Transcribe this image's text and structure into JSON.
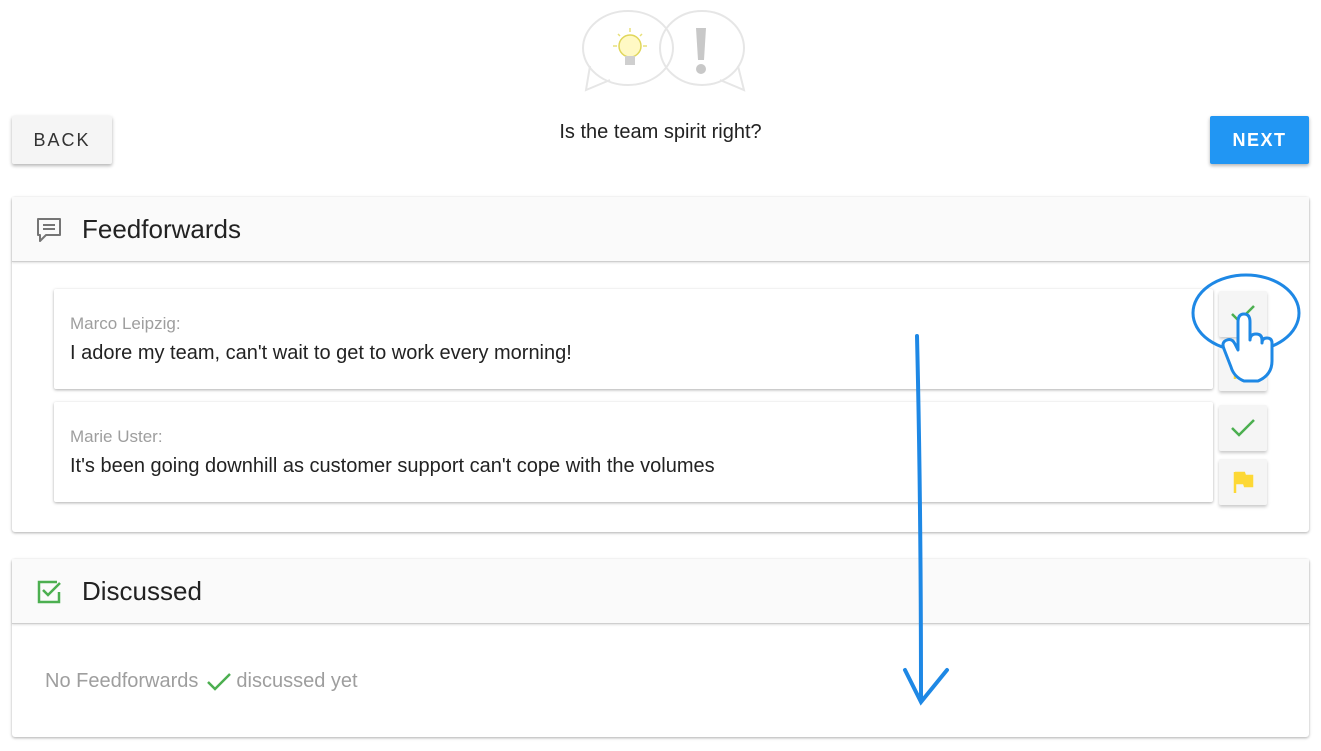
{
  "header": {
    "logo_icons": [
      "lightbulb-icon",
      "exclamation-icon"
    ],
    "back_label": "BACK",
    "next_label": "NEXT",
    "question": "Is the team spirit right?"
  },
  "feedforwards": {
    "title": "Feedforwards",
    "icon": "comment-icon",
    "items": [
      {
        "author": "Marco Leipzig:",
        "message": "I adore my team, can't wait to get to work every morning!"
      },
      {
        "author": "Marie Uster:",
        "message": "It's been going downhill as customer support can't cope with the volumes"
      }
    ],
    "actions": [
      "check-icon",
      "flag-icon"
    ]
  },
  "discussed": {
    "title": "Discussed",
    "icon": "checkbox-icon",
    "empty_prefix": "No Feedforwards",
    "empty_suffix": "discussed yet"
  },
  "colors": {
    "primary": "#2196f3",
    "check": "#4caf50",
    "flag": "#fdd835",
    "annotation": "#1e88e5"
  }
}
